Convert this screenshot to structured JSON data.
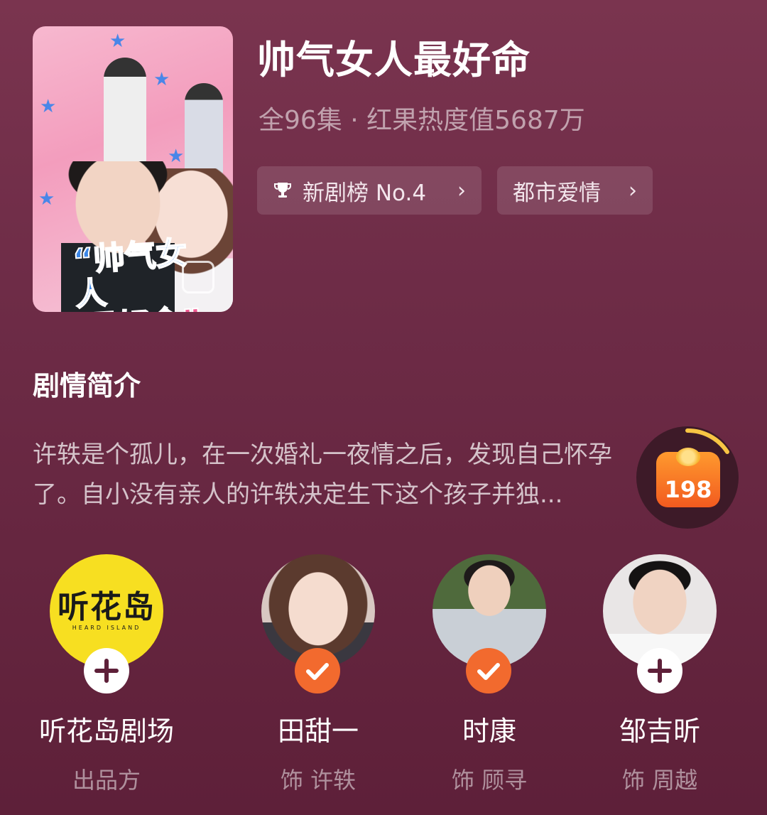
{
  "drama": {
    "title": "帅气女人最好命",
    "meta": "全96集 · 红果热度值5687万",
    "poster_title_line1": "“帅气女人",
    "poster_title_line2": "最好命”"
  },
  "tags": {
    "rank_label": "新剧榜 No.4",
    "genre_label": "都市爱情",
    "chevron": "›"
  },
  "synopsis": {
    "heading": "剧情简介",
    "line1": "许轶是个孤儿，在一次婚礼一夜情之后，发现自己怀孕",
    "line2": "了。自小没有亲人的许轶决定生下这个孩子并独..."
  },
  "reward": {
    "count": "198"
  },
  "cast": [
    {
      "name": "听花岛剧场",
      "role": "出品方",
      "badge": "plus",
      "logo_text": "听花岛",
      "logo_sub": "HEARD ISLAND"
    },
    {
      "name": "田甜一",
      "role": "饰 许轶",
      "badge": "check"
    },
    {
      "name": "时康",
      "role": "饰 顾寻",
      "badge": "check"
    },
    {
      "name": "邹吉昕",
      "role": "饰 周越",
      "badge": "plus"
    }
  ],
  "colors": {
    "accent_orange": "#f26a2e",
    "tag_bg": "rgba(255,255,255,0.12)",
    "bg_top": "#7a344f",
    "bg_bottom": "#5e2039"
  }
}
